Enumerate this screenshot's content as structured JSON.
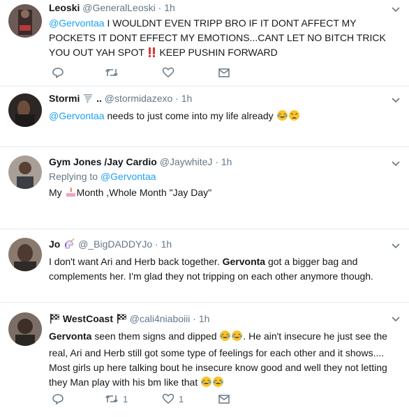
{
  "tweets": [
    {
      "name": "Leoski",
      "handle": "@GeneralLeoski",
      "time": "1h",
      "mention": "@Gervontaa",
      "text": " I WOULDNT EVEN TRIPP BRO IF IT DONT AFFECT MY POCKETS IT DONT EFFECT MY EMOTIONS...CANT LET NO BITCH TRICK YOU OUT YAH SPOT ",
      "text_tail": " KEEP PUSHIN FORWARD",
      "emoji": "double-exclamation",
      "actions": {
        "reply": "",
        "retweet": "",
        "like": "",
        "dm": ""
      }
    },
    {
      "name": "Stormi",
      "name_suffix": "..",
      "handle": "@stormidazexo",
      "time": "1h",
      "mention": "@Gervontaa",
      "text": " needs to just come into my life already ",
      "emoji": [
        "tears-of-joy",
        "weary-face"
      ],
      "actions": {
        "reply": "",
        "retweet": "",
        "like": "",
        "dm": ""
      }
    },
    {
      "name": "Gym Jones /Jay Cardio",
      "handle": "@JaywhiteJ",
      "time": "1h",
      "replying_label": "Replying to",
      "replying_mention": "@Gervontaa",
      "text_pre": "My ",
      "text_post": "Month ,Whole Month \"Jay Day\"",
      "emoji": "birthday-cake",
      "actions": {
        "reply": "",
        "retweet": "",
        "like": "",
        "dm": ""
      }
    },
    {
      "name": "Jo",
      "handle": "@_BigDADDYJo",
      "time": "1h",
      "text_pre": "I don't want Ari and Herb back together. ",
      "bold": "Gervonta",
      "text_post": " got a bigger bag and complements her. I'm glad they not tripping on each other anymore though.",
      "emoji": "unicorn",
      "actions": {
        "reply": "",
        "retweet": "",
        "like": "",
        "dm": ""
      }
    },
    {
      "name": "WestCoast",
      "handle": "@cali4niaboiii",
      "time": "1h",
      "bold": "Gervonta",
      "text_a": " seen them signs and dipped ",
      "text_b": ". He ain't insecure he just see the real, Ari and Herb still got some type of feelings for each other and it shows.... Most girls up here talking bout he insecure know good and well they not letting they Man play with his bm like that ",
      "emoji": [
        "chequered-flag",
        "tears-of-joy"
      ],
      "actions": {
        "reply": "",
        "retweet": "1",
        "like": "1",
        "dm": ""
      }
    }
  ],
  "colors": {
    "link": "#1da1f2",
    "muted": "#657786",
    "border": "#e6ecf0"
  }
}
